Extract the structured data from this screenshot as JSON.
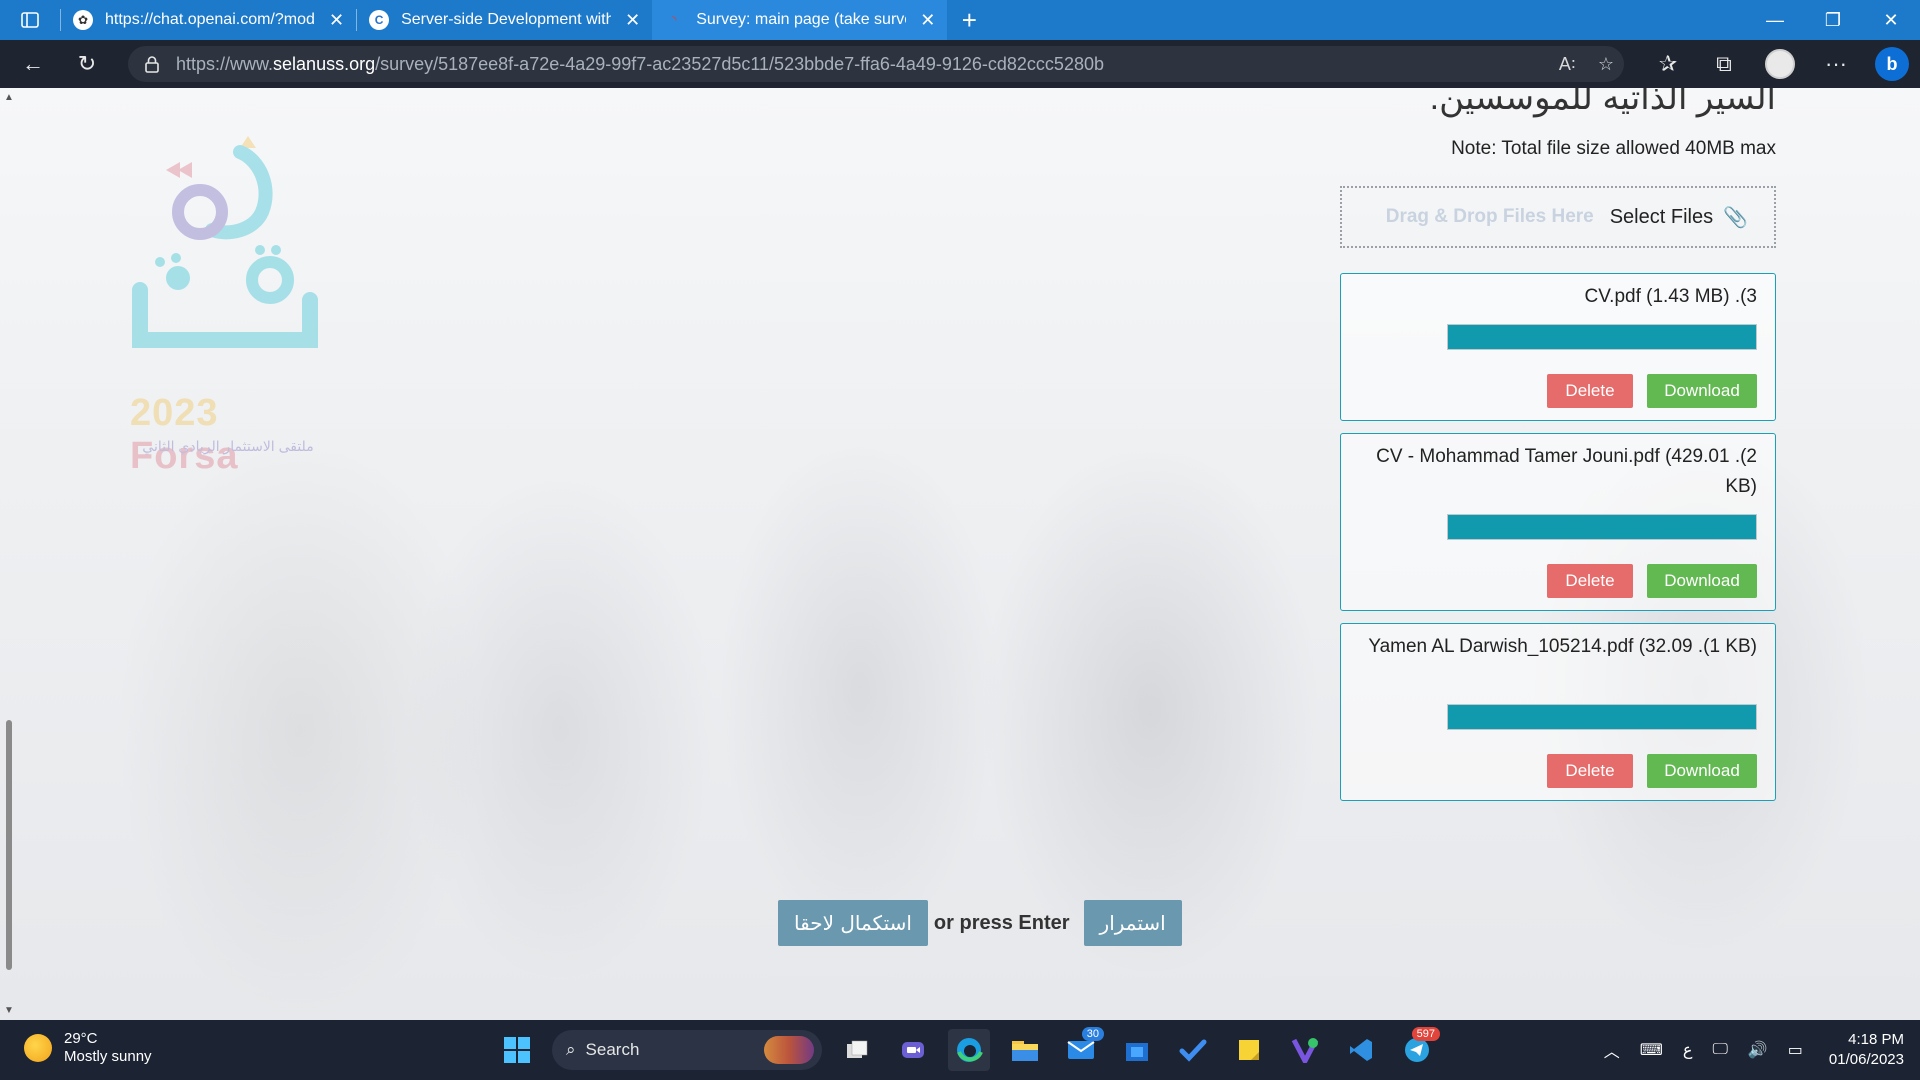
{
  "browser": {
    "tabs": [
      {
        "title": "https://chat.openai.com/?model=",
        "favicon": "openai-icon",
        "favicon_color": "#ffffff"
      },
      {
        "title": "Server-side Development with NodeJS",
        "favicon": "coursera-icon",
        "favicon_color": "#2a73cc"
      },
      {
        "title": "Survey: main page (take survey) | Sel",
        "favicon": "selanuss-icon",
        "favicon_color": "#e53935"
      }
    ],
    "url_prefix": "https://www.",
    "url_domain": "selanuss.org",
    "url_path": "/survey/5187ee8f-a72e-4a29-99f7-ac23527d5c11/523bbde7-ffa6-4a49-9126-cd82ccc5280b"
  },
  "page": {
    "heading": "السير الذاتيه للموسسين.",
    "note": "Note: Total file size allowed 40MB max",
    "dropzone": {
      "hint": "Drag & Drop Files Here",
      "select_label": "Select Files"
    },
    "logo": {
      "year": "2023",
      "name": "Forsa",
      "tagline": "ملتقى الاستثمار الريادي الثاني"
    },
    "files": [
      {
        "label": "CV.pdf (1.43 MB) .(3",
        "progress": 1.0,
        "delete": "Delete",
        "download": "Download"
      },
      {
        "label": "CV - Mohammad Tamer Jouni.pdf (429.01 .(2 KB)",
        "progress": 1.0,
        "delete": "Delete",
        "download": "Download"
      },
      {
        "label": "Yamen AL Darwish_105214.pdf (32.09 .(1 KB)",
        "progress": 1.0,
        "delete": "Delete",
        "download": "Download"
      }
    ],
    "actions": {
      "save_later": "استكمال لاحقا",
      "or_enter": "or press Enter",
      "continue": "استمرار"
    }
  },
  "taskbar": {
    "weather_temp": "29°C",
    "weather_desc": "Mostly sunny",
    "search_label": "Search",
    "mail_badge": "30",
    "telegram_badge": "597",
    "lang": "ع",
    "time": "4:18 PM",
    "date": "01/06/2023"
  },
  "colors": {
    "titlebar": "#1d79c9",
    "progress_fill": "#1199ad",
    "delete": "#e66b6b",
    "download": "#62b851",
    "action_button": "#6a98ae"
  }
}
